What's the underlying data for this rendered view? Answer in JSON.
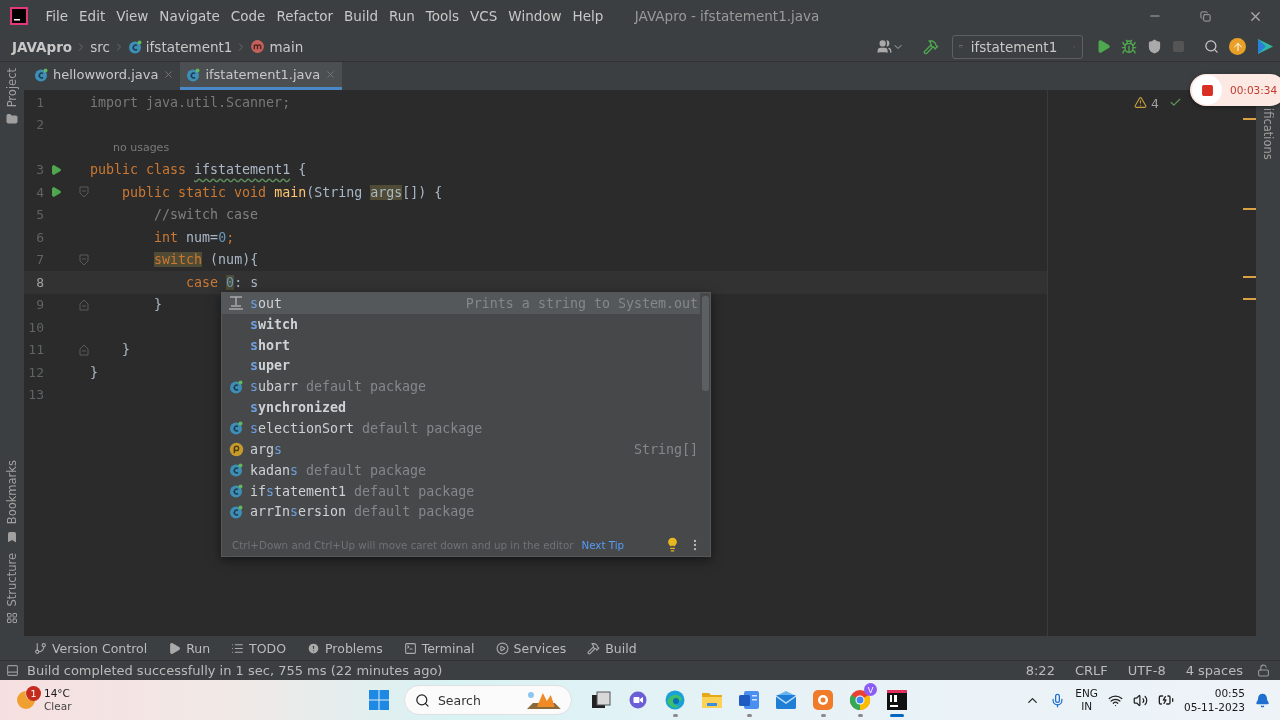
{
  "window": {
    "title": "JAVApro - ifstatement1.java"
  },
  "menu": [
    "File",
    "Edit",
    "View",
    "Navigate",
    "Code",
    "Refactor",
    "Build",
    "Run",
    "Tools",
    "VCS",
    "Window",
    "Help"
  ],
  "breadcrumbs": [
    {
      "label": "JAVApro",
      "kind": "project"
    },
    {
      "label": "src",
      "kind": "folder"
    },
    {
      "label": "ifstatement1",
      "kind": "class"
    },
    {
      "label": "main",
      "kind": "method"
    }
  ],
  "run_config": {
    "label": "ifstatement1"
  },
  "editor_tabs": [
    {
      "label": "hellowword.java",
      "selected": false
    },
    {
      "label": "ifstatement1.java",
      "selected": true
    }
  ],
  "left_tools_top": [
    "Project"
  ],
  "left_tools_bottom": [
    {
      "label": "Bookmarks",
      "kind": "bookmark"
    },
    {
      "label": "Structure",
      "kind": "structure"
    }
  ],
  "right_tools": [
    "ifications"
  ],
  "inspections": {
    "warnings": "4"
  },
  "recording": {
    "time": "00:03:34"
  },
  "code": {
    "lines": [
      {
        "kind": "code",
        "number": "1",
        "run": false,
        "fold_open": false,
        "fold_close": false,
        "current": false,
        "tokens": [
          {
            "text": "import java.util.Scanner;",
            "kind": "unused"
          }
        ]
      },
      {
        "kind": "code",
        "number": "2",
        "run": false,
        "fold_open": false,
        "fold_close": false,
        "current": false
      },
      {
        "kind": "inlay",
        "text": "no usages"
      },
      {
        "kind": "code",
        "number": "3",
        "run": true,
        "fold_open": false,
        "fold_close": false,
        "current": false,
        "tokens": [
          {
            "text": "public class ",
            "kind": "keyword"
          },
          {
            "text": "ifstatement1",
            "kind": "typo"
          },
          {
            "text": " {",
            "kind": "plain"
          }
        ]
      },
      {
        "kind": "code",
        "number": "4",
        "run": true,
        "fold_open": true,
        "fold_close": false,
        "current": false,
        "tokens": [
          {
            "text": "    public static void ",
            "kind": "keyword"
          },
          {
            "text": "main",
            "kind": "method"
          },
          {
            "text": "(String ",
            "kind": "plain"
          },
          {
            "text": "args",
            "kind": "plain-mark"
          },
          {
            "text": "[]) {",
            "kind": "plain"
          }
        ]
      },
      {
        "kind": "code",
        "number": "5",
        "run": false,
        "fold_open": false,
        "fold_close": false,
        "current": false,
        "tokens": [
          {
            "text": "        //switch case",
            "kind": "comment"
          }
        ]
      },
      {
        "kind": "code",
        "number": "6",
        "run": false,
        "fold_open": false,
        "fold_close": false,
        "current": false,
        "tokens": [
          {
            "text": "        int",
            "kind": "keyword"
          },
          {
            "text": " num=",
            "kind": "plain"
          },
          {
            "text": "0",
            "kind": "number"
          },
          {
            "text": ";",
            "kind": "keyword"
          }
        ]
      },
      {
        "kind": "code",
        "number": "7",
        "run": false,
        "fold_open": true,
        "fold_close": false,
        "current": false,
        "tokens": [
          {
            "text": "        switch",
            "kind": "keyword-mark"
          },
          {
            "text": " (num){",
            "kind": "plain"
          }
        ]
      },
      {
        "kind": "code",
        "number": "8",
        "run": false,
        "fold_open": false,
        "fold_close": false,
        "current": true,
        "tokens": [
          {
            "text": "            case ",
            "kind": "keyword"
          },
          {
            "text": "0",
            "kind": "number-mark"
          },
          {
            "text": ": s",
            "kind": "plain"
          }
        ]
      },
      {
        "kind": "code",
        "number": "9",
        "run": false,
        "fold_open": false,
        "fold_close": true,
        "current": false,
        "tokens": [
          {
            "text": "        }",
            "kind": "plain"
          }
        ]
      },
      {
        "kind": "code",
        "number": "10",
        "run": false,
        "fold_open": false,
        "fold_close": false,
        "current": false
      },
      {
        "kind": "code",
        "number": "11",
        "run": false,
        "fold_open": false,
        "fold_close": true,
        "current": false,
        "tokens": [
          {
            "text": "    }",
            "kind": "plain"
          }
        ]
      },
      {
        "kind": "code",
        "number": "12",
        "run": false,
        "fold_open": false,
        "fold_close": false,
        "current": false,
        "tokens": [
          {
            "text": "}",
            "kind": "plain"
          }
        ]
      },
      {
        "kind": "code",
        "number": "13",
        "run": false,
        "fold_open": false,
        "fold_close": false,
        "current": false
      }
    ]
  },
  "completion": {
    "items": [
      {
        "kind": "template",
        "selected": true,
        "keyword": false,
        "parts": [
          {
            "text": "s",
            "match": true
          },
          {
            "text": "out",
            "match": false
          }
        ],
        "hint": "Prints a string to System.out"
      },
      {
        "kind": "keyword",
        "selected": false,
        "keyword": true,
        "parts": [
          {
            "text": "s",
            "match": true
          },
          {
            "text": "witch",
            "match": false
          }
        ]
      },
      {
        "kind": "keyword",
        "selected": false,
        "keyword": true,
        "parts": [
          {
            "text": "s",
            "match": true
          },
          {
            "text": "hort",
            "match": false
          }
        ]
      },
      {
        "kind": "keyword",
        "selected": false,
        "keyword": true,
        "parts": [
          {
            "text": "s",
            "match": true
          },
          {
            "text": "uper",
            "match": false
          }
        ]
      },
      {
        "kind": "class",
        "selected": false,
        "keyword": false,
        "parts": [
          {
            "text": "s",
            "match": true
          },
          {
            "text": "ubarr",
            "match": false
          }
        ],
        "detail": "default package"
      },
      {
        "kind": "keyword",
        "selected": false,
        "keyword": true,
        "parts": [
          {
            "text": "s",
            "match": true
          },
          {
            "text": "ynchronized",
            "match": false
          }
        ]
      },
      {
        "kind": "class",
        "selected": false,
        "keyword": false,
        "parts": [
          {
            "text": "s",
            "match": true
          },
          {
            "text": "electionSort",
            "match": false
          }
        ],
        "detail": "default package"
      },
      {
        "kind": "parameter",
        "selected": false,
        "keyword": false,
        "parts": [
          {
            "text": "arg",
            "match": false
          },
          {
            "text": "s",
            "match": true
          }
        ],
        "hint": "String[]"
      },
      {
        "kind": "class",
        "selected": false,
        "keyword": false,
        "parts": [
          {
            "text": "kadan",
            "match": false
          },
          {
            "text": "s",
            "match": true
          }
        ],
        "detail": "default package"
      },
      {
        "kind": "class",
        "selected": false,
        "keyword": false,
        "parts": [
          {
            "text": "if",
            "match": false
          },
          {
            "text": "s",
            "match": true
          },
          {
            "text": "tatement1",
            "match": false
          }
        ],
        "detail": "default package"
      },
      {
        "kind": "class",
        "selected": false,
        "keyword": false,
        "parts": [
          {
            "text": "arrIn",
            "match": false
          },
          {
            "text": "s",
            "match": true
          },
          {
            "text": "ersion",
            "match": false
          }
        ],
        "detail": "default package"
      }
    ],
    "tip": "Ctrl+Down and Ctrl+Up will move caret down and up in the editor",
    "tip_link": "Next Tip"
  },
  "tool_windows": [
    {
      "label": "Version Control",
      "kind": "branch"
    },
    {
      "label": "Run",
      "kind": "run"
    },
    {
      "label": "TODO",
      "kind": "list"
    },
    {
      "label": "Problems",
      "kind": "problems"
    },
    {
      "label": "Terminal",
      "kind": "terminal"
    },
    {
      "label": "Services",
      "kind": "services"
    },
    {
      "label": "Build",
      "kind": "build"
    }
  ],
  "status_bar": {
    "message": "Build completed successfully in 1 sec, 755 ms (22 minutes ago)",
    "items": [
      "8:22",
      "CRLF",
      "UTF-8",
      "4 spaces"
    ]
  },
  "taskbar": {
    "weather": {
      "badge": "1",
      "temperature": "14°C",
      "condition": "Clear"
    },
    "search": {
      "label": "Search"
    },
    "apps": [
      {
        "kind": "task-view",
        "running": false,
        "active": false
      },
      {
        "kind": "chat",
        "running": false,
        "active": false
      },
      {
        "kind": "edge",
        "running": true,
        "active": false
      },
      {
        "kind": "explorer",
        "running": false,
        "active": false
      },
      {
        "kind": "word",
        "running": true,
        "active": false
      },
      {
        "kind": "mail",
        "running": false,
        "active": false
      },
      {
        "kind": "camera",
        "running": true,
        "active": false
      },
      {
        "kind": "chrome",
        "running": true,
        "active": false,
        "badge": "V"
      },
      {
        "kind": "intellij",
        "running": true,
        "active": true
      }
    ],
    "language": "ENG",
    "region": "IN",
    "time": "00:55",
    "date": "05-11-2023"
  }
}
